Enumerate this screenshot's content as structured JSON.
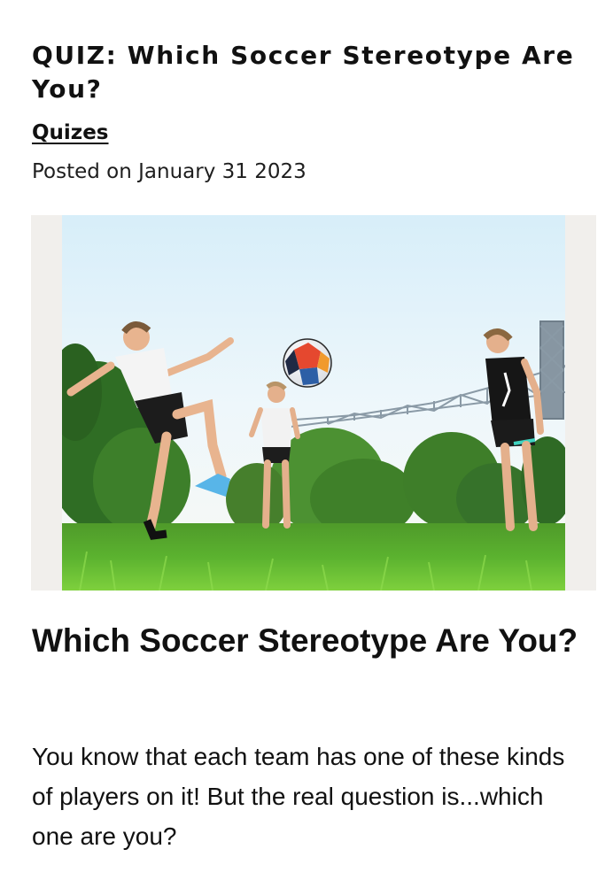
{
  "post": {
    "title": "QUIZ: Which Soccer Stereotype Are You?",
    "category": "Quizes",
    "date": "Posted on January 31 2023"
  },
  "hero_image": {
    "description_icon": "soccer-photo"
  },
  "article": {
    "heading": "Which Soccer Stereotype Are You?",
    "intro": "You know that each team has one of these kinds of players on it! But the real question is...which one are you?"
  }
}
